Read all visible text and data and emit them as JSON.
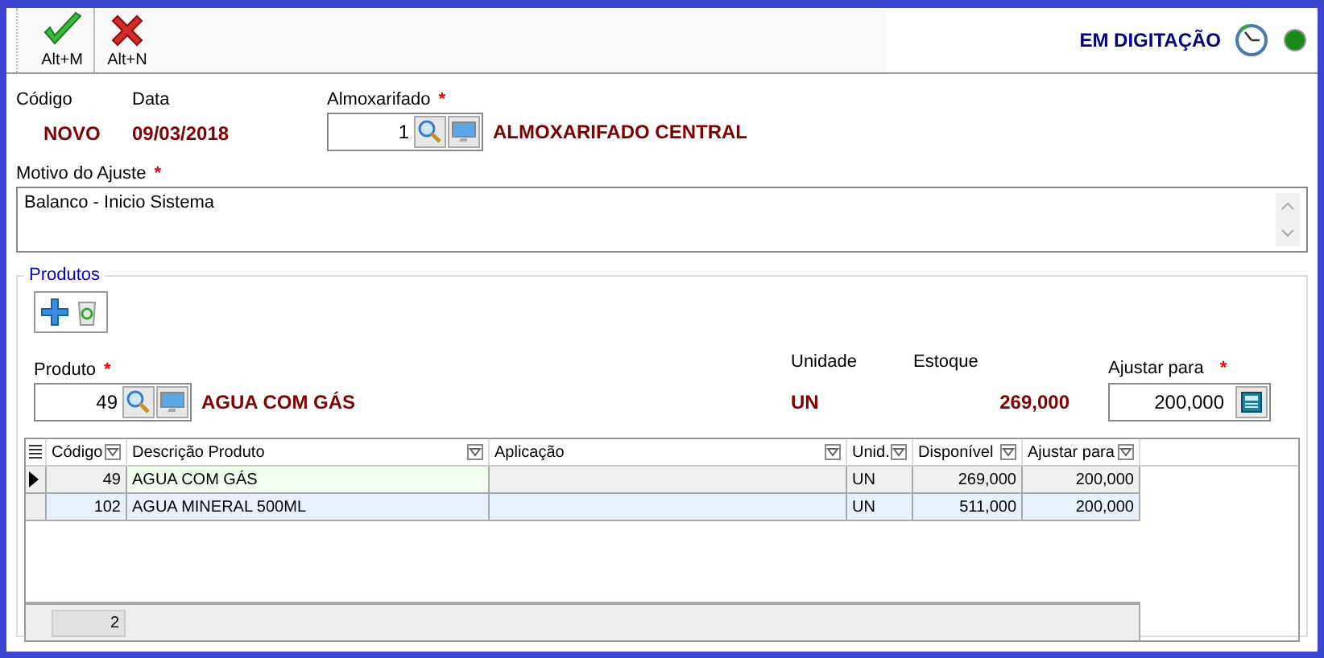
{
  "toolbar": {
    "buttons": [
      {
        "kind": "confirm",
        "label": "Alt+M"
      },
      {
        "kind": "cancel",
        "label": "Alt+N"
      }
    ],
    "status": "EM DIGITAÇÃO"
  },
  "header": {
    "codigo_label": "Código",
    "codigo": "NOVO",
    "data_label": "Data",
    "data": "09/03/2018",
    "almox_label": "Almoxarifado",
    "almox_required": "*",
    "almox_code": "1",
    "almox_name": "ALMOXARIFADO CENTRAL"
  },
  "motivo": {
    "label": "Motivo do Ajuste",
    "required": "*",
    "value": "Balanco - Inicio Sistema"
  },
  "produtos": {
    "title": "Produtos",
    "produto_label": "Produto",
    "produto_required": "*",
    "produto_code": "49",
    "produto_name": "AGUA COM GÁS",
    "unidade_label": "Unidade",
    "unidade": "UN",
    "estoque_label": "Estoque",
    "estoque": "269,000",
    "ajustar_label": "Ajustar para",
    "ajustar_required": "*",
    "ajustar_value": "200,000"
  },
  "table": {
    "columns": [
      "Código",
      "Descrição Produto",
      "Aplicação",
      "Unid.",
      "Disponível",
      "Ajustar para"
    ],
    "rows": [
      {
        "selected": true,
        "cells": [
          "49",
          "AGUA COM GÁS",
          "",
          "UN",
          "269,000",
          "200,000"
        ]
      },
      {
        "selected": false,
        "cells": [
          "102",
          "AGUA MINERAL 500ML",
          "",
          "UN",
          "511,000",
          "200,000"
        ]
      }
    ],
    "footer_count": "2"
  }
}
